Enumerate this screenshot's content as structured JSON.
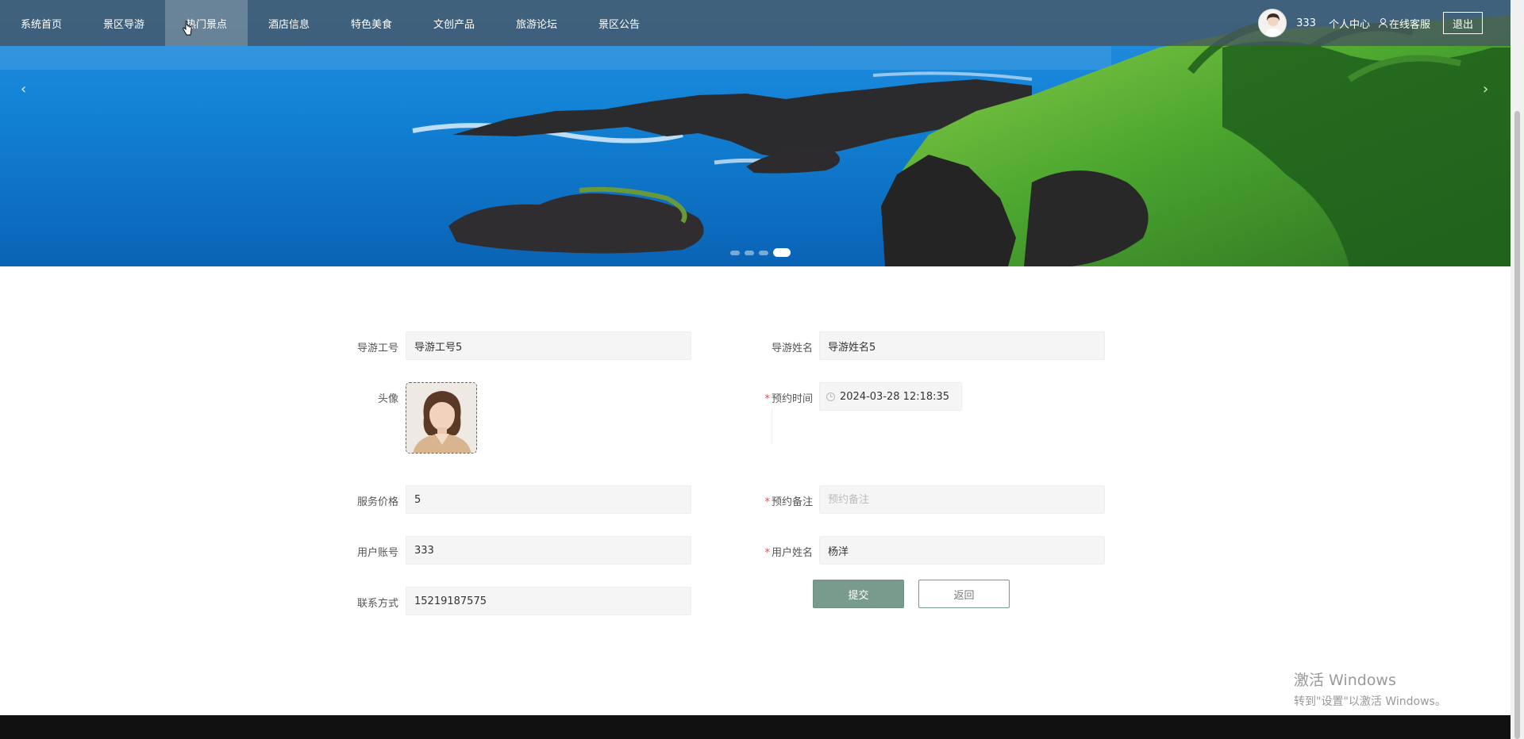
{
  "nav": {
    "items": [
      {
        "label": "系统首页"
      },
      {
        "label": "景区导游"
      },
      {
        "label": "热门景点"
      },
      {
        "label": "酒店信息"
      },
      {
        "label": "特色美食"
      },
      {
        "label": "文创产品"
      },
      {
        "label": "旅游论坛"
      },
      {
        "label": "景区公告"
      }
    ],
    "active_label": "热门景点",
    "username": "333",
    "personal_center": "个人中心",
    "online_service": "在线客服",
    "logout": "退出"
  },
  "carousel": {
    "prev": "‹",
    "next": "›",
    "slide_count": 4,
    "active_index": 3
  },
  "form": {
    "guide_id": {
      "label": "导游工号",
      "value": "导游工号5"
    },
    "guide_name": {
      "label": "导游姓名",
      "value": "导游姓名5"
    },
    "avatar": {
      "label": "头像"
    },
    "booking_time": {
      "label": "预约时间",
      "value": "2024-03-28 12:18:35",
      "required": true
    },
    "price": {
      "label": "服务价格",
      "value": "5"
    },
    "remark": {
      "label": "预约备注",
      "placeholder": "预约备注",
      "value": "",
      "required": true
    },
    "user_account": {
      "label": "用户账号",
      "value": "333"
    },
    "user_name": {
      "label": "用户姓名",
      "value": "杨洋",
      "required": true
    },
    "contact": {
      "label": "联系方式",
      "value": "15219187575"
    },
    "required_mark": "*",
    "submit": "提交",
    "back": "返回"
  },
  "watermark": {
    "title": "激活 Windows",
    "subtitle": "转到\"设置\"以激活 Windows。"
  },
  "colors": {
    "navbar": "#465460",
    "submit": "#789b8e",
    "required": "#e05050"
  }
}
